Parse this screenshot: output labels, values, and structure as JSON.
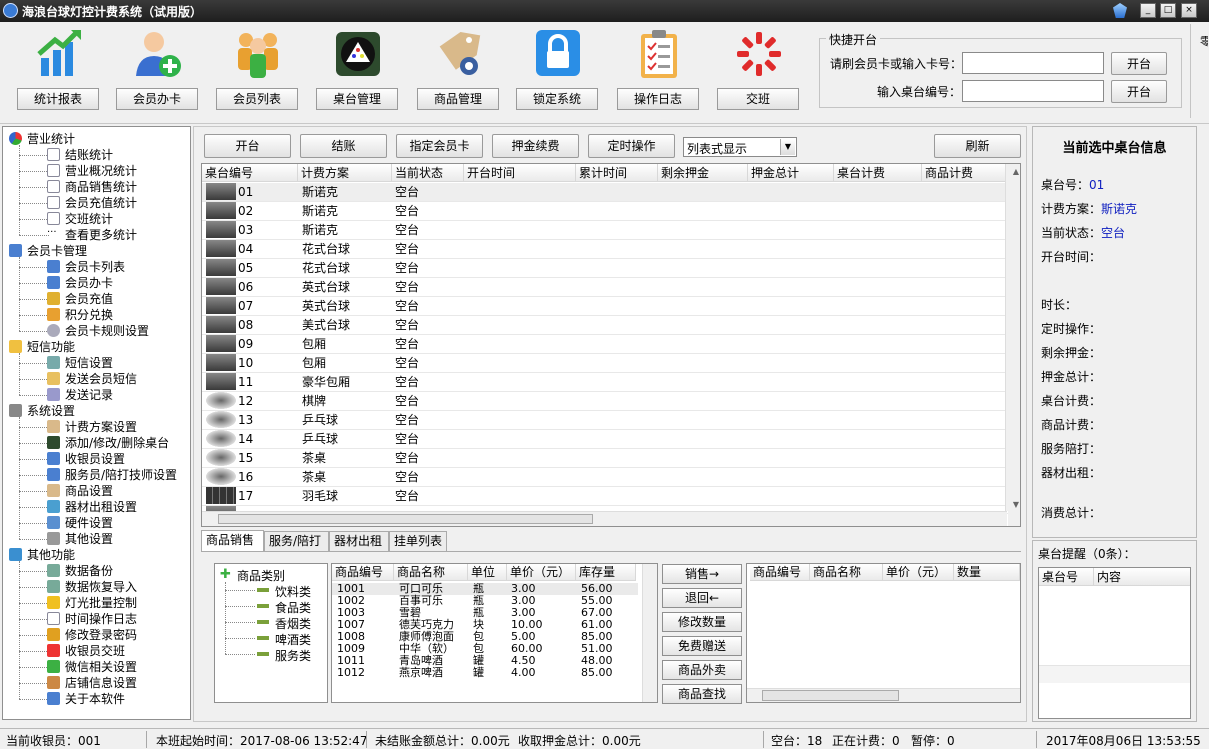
{
  "window": {
    "title": "海浪台球灯控计费系统（试用版）",
    "controls": [
      "_",
      "□",
      "×"
    ]
  },
  "toolbar": [
    {
      "name": "stats-report",
      "label": "统计报表",
      "icon": "bar-chart-icon"
    },
    {
      "name": "member-card",
      "label": "会员办卡",
      "icon": "add-user-icon"
    },
    {
      "name": "member-list",
      "label": "会员列表",
      "icon": "users-icon"
    },
    {
      "name": "table-manage",
      "label": "桌台管理",
      "icon": "billiard-rack-icon"
    },
    {
      "name": "goods-manage",
      "label": "商品管理",
      "icon": "tag-gear-icon"
    },
    {
      "name": "lock-system",
      "label": "锁定系统",
      "icon": "lock-icon"
    },
    {
      "name": "operation-log",
      "label": "操作日志",
      "icon": "clipboard-icon"
    },
    {
      "name": "shift-change",
      "label": "交班",
      "icon": "spinner-icon"
    }
  ],
  "quick": {
    "legend": "快捷开台",
    "card_label": "请刷会员卡或输入卡号：",
    "table_label": "输入桌台编号：",
    "open_btn": "开台",
    "edge": "零"
  },
  "tree": [
    {
      "label": "营业统计",
      "level": 0,
      "icon": "pie-icon"
    },
    {
      "label": "结账统计",
      "level": 1,
      "icon": "doc-icon"
    },
    {
      "label": "营业概况统计",
      "level": 1,
      "icon": "doc-icon"
    },
    {
      "label": "商品销售统计",
      "level": 1,
      "icon": "doc-icon"
    },
    {
      "label": "会员充值统计",
      "level": 1,
      "icon": "doc-icon"
    },
    {
      "label": "交班统计",
      "level": 1,
      "icon": "doc-icon"
    },
    {
      "label": "查看更多统计",
      "level": 1,
      "icon": "more-icon"
    },
    {
      "label": "会员卡管理",
      "level": 0,
      "icon": "user-icon"
    },
    {
      "label": "会员卡列表",
      "level": 1,
      "icon": "user-icon"
    },
    {
      "label": "会员办卡",
      "level": 1,
      "icon": "user-icon"
    },
    {
      "label": "会员充值",
      "level": 1,
      "icon": "coins-icon"
    },
    {
      "label": "积分兑换",
      "level": 1,
      "icon": "gift-icon"
    },
    {
      "label": "会员卡规则设置",
      "level": 1,
      "icon": "cd-icon"
    },
    {
      "label": "短信功能",
      "level": 0,
      "icon": "mail-icon"
    },
    {
      "label": "短信设置",
      "level": 1,
      "icon": "phone-icon"
    },
    {
      "label": "发送会员短信",
      "level": 1,
      "icon": "send-icon"
    },
    {
      "label": "发送记录",
      "level": 1,
      "icon": "list-icon"
    },
    {
      "label": "系统设置",
      "level": 0,
      "icon": "gear-icon"
    },
    {
      "label": "计费方案设置",
      "level": 1,
      "icon": "tag-icon"
    },
    {
      "label": "添加/修改/删除桌台",
      "level": 1,
      "icon": "table-icon"
    },
    {
      "label": "收银员设置",
      "level": 1,
      "icon": "user-icon"
    },
    {
      "label": "服务员/陪打技师设置",
      "level": 1,
      "icon": "user-icon"
    },
    {
      "label": "商品设置",
      "level": 1,
      "icon": "tag-icon"
    },
    {
      "label": "器材出租设置",
      "level": 1,
      "icon": "link-icon"
    },
    {
      "label": "硬件设置",
      "level": 1,
      "icon": "chip-icon"
    },
    {
      "label": "其他设置",
      "level": 1,
      "icon": "tools-icon"
    },
    {
      "label": "其他功能",
      "level": 0,
      "icon": "box-icon"
    },
    {
      "label": "数据备份",
      "level": 1,
      "icon": "db-icon"
    },
    {
      "label": "数据恢复导入",
      "level": 1,
      "icon": "db-icon"
    },
    {
      "label": "灯光批量控制",
      "level": 1,
      "icon": "bulb-icon"
    },
    {
      "label": "时间操作日志",
      "level": 1,
      "icon": "doc-icon"
    },
    {
      "label": "修改登录密码",
      "level": 1,
      "icon": "key-icon"
    },
    {
      "label": "收银员交班",
      "level": 1,
      "icon": "spinner-icon"
    },
    {
      "label": "微信相关设置",
      "level": 1,
      "icon": "wechat-icon"
    },
    {
      "label": "店铺信息设置",
      "level": 1,
      "icon": "store-icon"
    },
    {
      "label": "关于本软件",
      "level": 1,
      "icon": "info-icon"
    }
  ],
  "actions": {
    "open": "开台",
    "checkout": "结账",
    "assign_card": "指定会员卡",
    "deposit": "押金续费",
    "timer": "定时操作",
    "view_mode": "列表式显示",
    "refresh": "刷新"
  },
  "grid": {
    "headers": [
      "桌台编号",
      "计费方案",
      "当前状态",
      "开台时间",
      "累计时间",
      "剩余押金",
      "押金总计",
      "桌台计费",
      "商品计费"
    ],
    "rows": [
      {
        "no": "01",
        "plan": "斯诺克",
        "status": "空台",
        "thumb": "snooker"
      },
      {
        "no": "02",
        "plan": "斯诺克",
        "status": "空台",
        "thumb": "snooker"
      },
      {
        "no": "03",
        "plan": "斯诺克",
        "status": "空台",
        "thumb": "snooker"
      },
      {
        "no": "04",
        "plan": "花式台球",
        "status": "空台",
        "thumb": "snooker"
      },
      {
        "no": "05",
        "plan": "花式台球",
        "status": "空台",
        "thumb": "snooker"
      },
      {
        "no": "06",
        "plan": "英式台球",
        "status": "空台",
        "thumb": "snooker"
      },
      {
        "no": "07",
        "plan": "英式台球",
        "status": "空台",
        "thumb": "snooker"
      },
      {
        "no": "08",
        "plan": "美式台球",
        "status": "空台",
        "thumb": "snooker"
      },
      {
        "no": "09",
        "plan": "包厢",
        "status": "空台",
        "thumb": "snooker"
      },
      {
        "no": "10",
        "plan": "包厢",
        "status": "空台",
        "thumb": "snooker"
      },
      {
        "no": "11",
        "plan": "豪华包厢",
        "status": "空台",
        "thumb": "snooker"
      },
      {
        "no": "12",
        "plan": "棋牌",
        "status": "空台",
        "thumb": "mahjong"
      },
      {
        "no": "13",
        "plan": "乒乓球",
        "status": "空台",
        "thumb": "pingpong"
      },
      {
        "no": "14",
        "plan": "乒乓球",
        "status": "空台",
        "thumb": "pingpong"
      },
      {
        "no": "15",
        "plan": "茶桌",
        "status": "空台",
        "thumb": "tea"
      },
      {
        "no": "16",
        "plan": "茶桌",
        "status": "空台",
        "thumb": "tea"
      },
      {
        "no": "17",
        "plan": "羽毛球",
        "status": "空台",
        "thumb": "badminton"
      }
    ]
  },
  "tabs": [
    "商品销售",
    "服务/陪打",
    "器材出租",
    "挂单列表"
  ],
  "goods": {
    "categories_root": "商品类别",
    "categories": [
      "饮料类",
      "食品类",
      "香烟类",
      "啤酒类",
      "服务类"
    ],
    "headers": [
      "商品编号",
      "商品名称",
      "单位",
      "单价（元）",
      "库存量"
    ],
    "rows": [
      [
        "1001",
        "可口可乐",
        "瓶",
        "3.00",
        "56.00"
      ],
      [
        "1002",
        "百事可乐",
        "瓶",
        "3.00",
        "55.00"
      ],
      [
        "1003",
        "雪碧",
        "瓶",
        "3.00",
        "67.00"
      ],
      [
        "1007",
        "德芙巧克力",
        "块",
        "10.00",
        "61.00"
      ],
      [
        "1008",
        "康师傅泡面",
        "包",
        "5.00",
        "85.00"
      ],
      [
        "1009",
        "中华（软）",
        "包",
        "60.00",
        "51.00"
      ],
      [
        "1011",
        "青岛啤酒",
        "罐",
        "4.50",
        "48.00"
      ],
      [
        "1012",
        "燕京啤酒",
        "罐",
        "4.00",
        "85.00"
      ]
    ],
    "buttons": [
      "销售→",
      "退回←",
      "修改数量",
      "免费赠送",
      "商品外卖",
      "商品查找"
    ],
    "cart_headers": [
      "商品编号",
      "商品名称",
      "单价（元）",
      "数量"
    ]
  },
  "info": {
    "title": "当前选中桌台信息",
    "fields": [
      {
        "label": "桌台号：",
        "value": "01"
      },
      {
        "label": "计费方案：",
        "value": "斯诺克"
      },
      {
        "label": "当前状态：",
        "value": "空台"
      },
      {
        "label": "开台时间：",
        "value": ""
      },
      {
        "label": "时长：",
        "value": ""
      },
      {
        "label": "定时操作：",
        "value": ""
      },
      {
        "label": "剩余押金：",
        "value": ""
      },
      {
        "label": "押金总计：",
        "value": ""
      },
      {
        "label": "桌台计费：",
        "value": ""
      },
      {
        "label": "商品计费：",
        "value": ""
      },
      {
        "label": "服务陪打：",
        "value": ""
      },
      {
        "label": "器材出租：",
        "value": ""
      },
      {
        "label": "消费总计：",
        "value": ""
      }
    ]
  },
  "reminder": {
    "title": "桌台提醒（0条）：",
    "headers": [
      "桌台号",
      "内容"
    ]
  },
  "status": {
    "cashier": "当前收银员：001",
    "shift_start": "本班起始时间：2017-08-06 13:52:47",
    "unsettled": "未结账金额总计：0.00元",
    "deposit": "收取押金总计：0.00元",
    "idle": "空台：18",
    "billing": "正在计费：0",
    "paused": "暂停：0",
    "datetime": "2017年08月06日 13:53:55"
  }
}
